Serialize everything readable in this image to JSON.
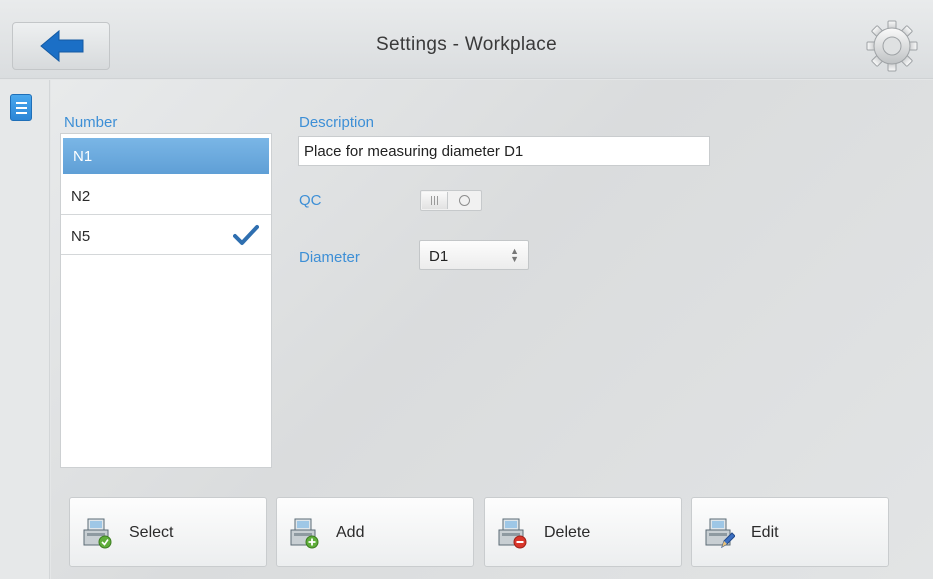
{
  "header": {
    "title": "Settings - Workplace",
    "back_icon": "arrow-left-icon",
    "settings_icon": "gear-icon"
  },
  "sidebar": {
    "menu_icon": "menu-icon"
  },
  "list": {
    "header": "Number",
    "items": [
      {
        "label": "N1",
        "selected": true,
        "checked": false
      },
      {
        "label": "N2",
        "selected": false,
        "checked": false
      },
      {
        "label": "N5",
        "selected": false,
        "checked": true
      }
    ]
  },
  "form": {
    "description_label": "Description",
    "description_value": "Place for measuring diameter D1",
    "qc_label": "QC",
    "qc_enabled": false,
    "diameter_label": "Diameter",
    "diameter_value": "D1"
  },
  "buttons": {
    "select": "Select",
    "add": "Add",
    "delete": "Delete",
    "edit": "Edit"
  },
  "colors": {
    "accent": "#3d8fd6",
    "selected_row": "#6aa9de",
    "back_arrow": "#1b6fc6",
    "check": "#2f6fb0"
  }
}
